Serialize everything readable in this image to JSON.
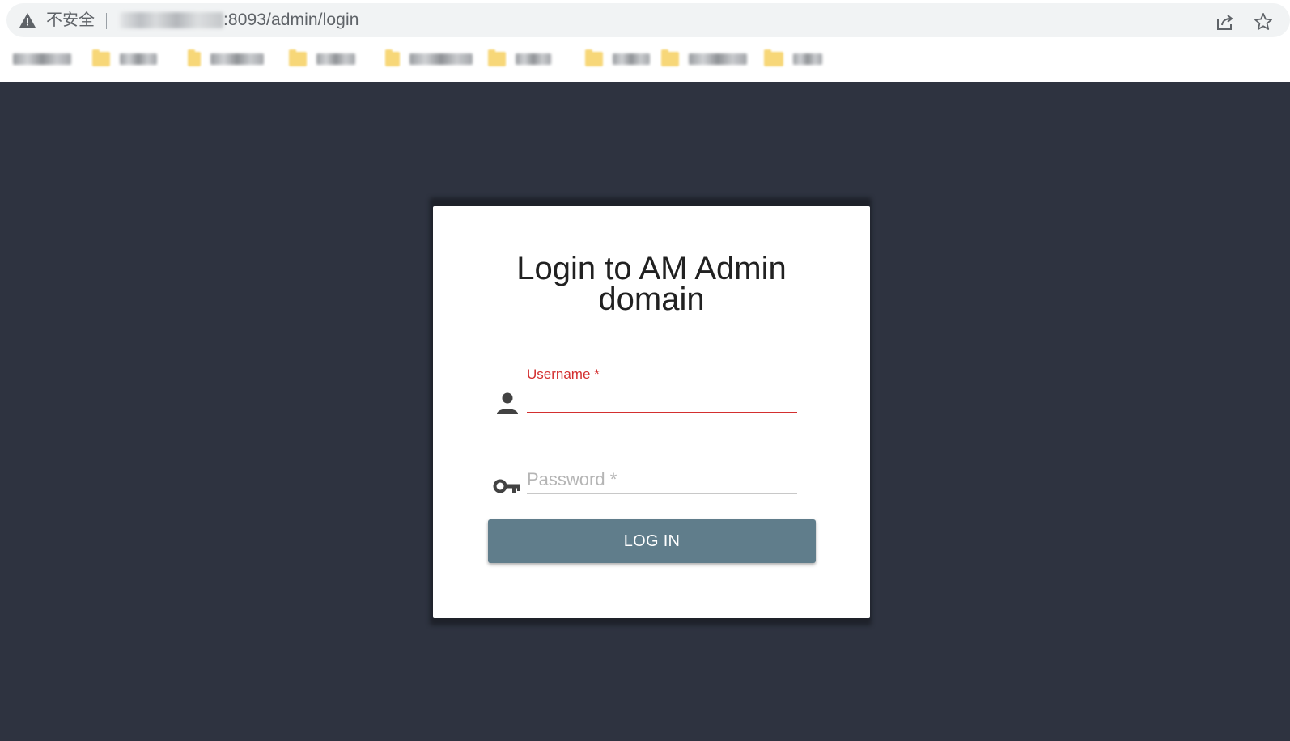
{
  "browser": {
    "security_label": "不安全",
    "url_visible": ":8093/admin/login",
    "icons": {
      "security": "warning-triangle-icon",
      "share": "share-icon",
      "bookmark": "star-icon"
    },
    "bookmarks_count_visible": 9
  },
  "login": {
    "title": "Login to AM Admin domain",
    "username": {
      "label": "Username *",
      "value": "",
      "icon": "person-icon"
    },
    "password": {
      "placeholder": "Password *",
      "value": "",
      "icon": "key-icon"
    },
    "submit_label": "LOG IN"
  },
  "colors": {
    "page_background": "#2e3340",
    "card_background": "#ffffff",
    "error_red": "#d32f2f",
    "button_background": "#607d8b",
    "button_text": "#ffffff",
    "folder_yellow": "#f7d778"
  }
}
